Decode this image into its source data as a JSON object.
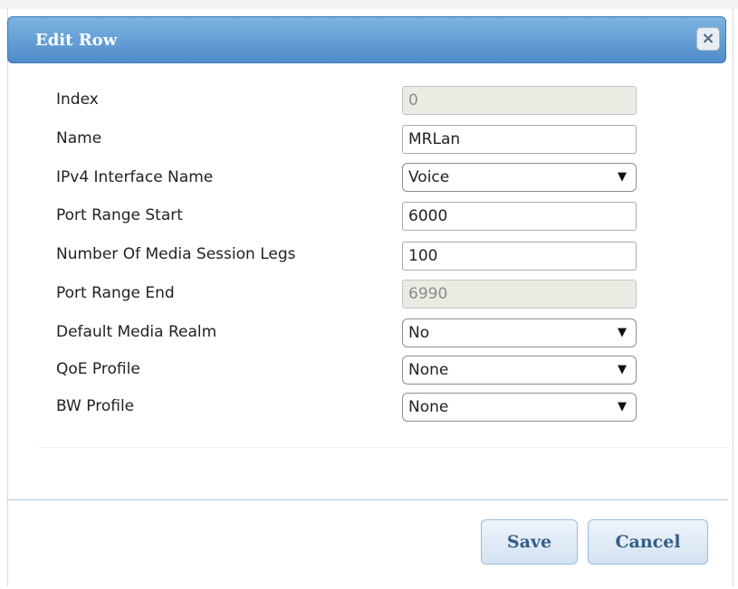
{
  "background": {
    "partial_text": "..."
  },
  "dialog": {
    "title": "Edit Row",
    "close_symbol": "×",
    "fields": [
      {
        "label": "Index",
        "value": "0",
        "type": "text",
        "disabled": true
      },
      {
        "label": "Name",
        "value": "MRLan",
        "type": "text",
        "disabled": false
      },
      {
        "label": "IPv4 Interface Name",
        "value": "Voice",
        "type": "select",
        "disabled": false
      },
      {
        "label": "Port Range Start",
        "value": "6000",
        "type": "text",
        "disabled": false
      },
      {
        "label": "Number Of Media Session Legs",
        "value": "100",
        "type": "text",
        "disabled": false
      },
      {
        "label": "Port Range End",
        "value": "6990",
        "type": "text",
        "disabled": true
      },
      {
        "label": "Default Media Realm",
        "value": "No",
        "type": "select",
        "disabled": false
      },
      {
        "label": "QoE Profile",
        "value": "None",
        "type": "select",
        "disabled": false
      },
      {
        "label": "BW Profile",
        "value": "None",
        "type": "select",
        "disabled": false
      }
    ],
    "buttons": {
      "save": "Save",
      "cancel": "Cancel"
    },
    "select_arrow": "▼"
  },
  "colors": {
    "titlebar_top": "#7db3e2",
    "titlebar_bottom": "#4f8cc9",
    "button_text": "#365d86"
  }
}
